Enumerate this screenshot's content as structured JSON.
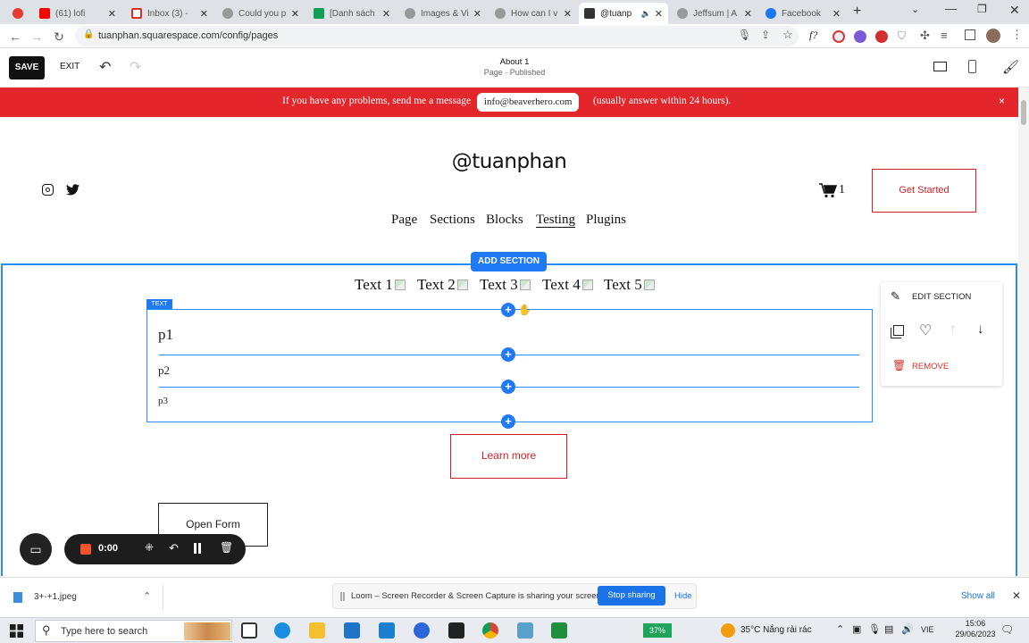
{
  "browser": {
    "tabs": [
      {
        "label": "",
        "color": "#e53935"
      },
      {
        "label": "(61) lofi",
        "color": "#ff0000"
      },
      {
        "label": "Inbox (3) -",
        "color": "#d93025"
      },
      {
        "label": "Could you p",
        "color": "#666666"
      },
      {
        "label": "[Danh sách",
        "color": "#0f9d58"
      },
      {
        "label": "Images & Vi",
        "color": "#666666"
      },
      {
        "label": "How can I v",
        "color": "#666666"
      },
      {
        "label": "@tuanp",
        "color": "#333333"
      },
      {
        "label": "Jeffsum | A",
        "color": "#666666"
      },
      {
        "label": "Facebook",
        "color": "#1877f2"
      }
    ],
    "url": "tuanphan.squarespace.com/config/pages"
  },
  "toolbar": {
    "save_label": "SAVE",
    "exit_label": "EXIT",
    "page_title": "About 1",
    "page_status": "Page · Published"
  },
  "announcement": {
    "before": "If you have any problems, send me a message",
    "email": "info@beaverhero.com",
    "after": "(usually answer within 24 hours).",
    "close": "×"
  },
  "site": {
    "title": "@tuanphan",
    "cart_count": "1",
    "get_started": "Get Started",
    "nav": [
      "Page",
      "Sections",
      "Blocks",
      "Testing",
      "Plugins"
    ],
    "active_nav": "Testing"
  },
  "section": {
    "add_section": "ADD SECTION",
    "text_items": [
      "Text 1",
      "Text 2",
      "Text 3",
      "Text 4",
      "Text 5"
    ],
    "text_tag": "TEXT",
    "paragraphs": [
      "p1",
      "p2",
      "p3"
    ],
    "learn_more": "Learn more",
    "open_form": "Open Form"
  },
  "edit_panel": {
    "edit_section": "EDIT SECTION",
    "remove": "REMOVE"
  },
  "loom": {
    "timer": "0:00",
    "share_message": "Loom – Screen Recorder & Screen Capture is sharing your screen.",
    "stop_sharing": "Stop sharing",
    "hide": "Hide"
  },
  "downloads": {
    "file": "3+-+1.jpeg",
    "show_all": "Show all"
  },
  "taskbar": {
    "search_placeholder": "Type here to search",
    "battery": "37%",
    "weather": "35°C  Nắng rải rác",
    "lang": "VIE",
    "time": "15:06",
    "date": "29/06/2023"
  },
  "colors": {
    "accent": "#2079f5",
    "brand_red": "#e2262c",
    "button_red": "#cf2228"
  }
}
